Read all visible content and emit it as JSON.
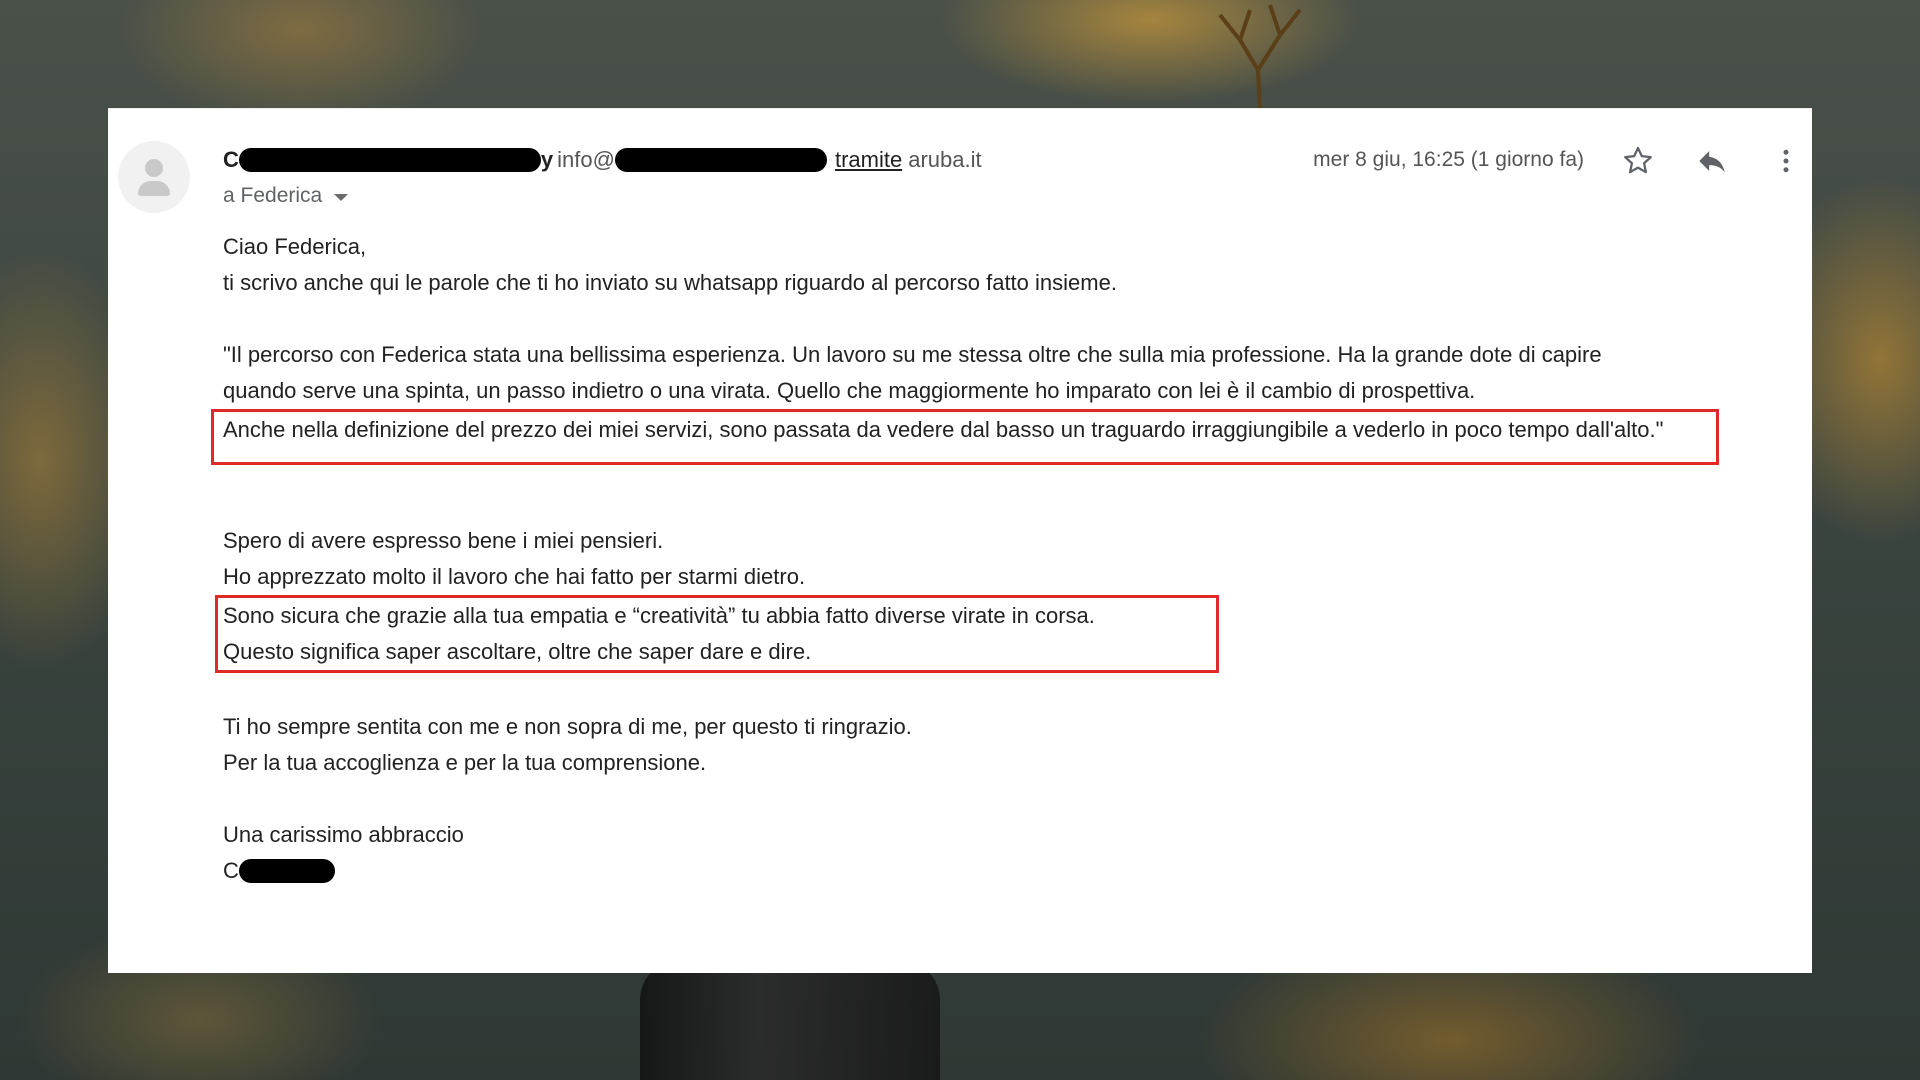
{
  "email": {
    "sender": {
      "name_prefix": "C",
      "name_suffix": "y",
      "email_prefix": "info@",
      "via_label": "tramite",
      "via_domain": "aruba.it"
    },
    "recipient_label": "a Federica",
    "date": "mer 8 giu, 16:25 (1 giorno fa)",
    "body": {
      "greeting": "Ciao Federica,",
      "intro": "ti scrivo anche qui le parole che ti ho inviato su whatsapp riguardo al percorso fatto insieme.",
      "quote_line1": "\"Il percorso con Federica stata una bellissima esperienza. Un lavoro su me stessa oltre che sulla mia professione. Ha la grande dote di capire",
      "quote_line2": "quando serve una spinta, un passo indietro o una virata. Quello che maggiormente ho imparato con lei è il cambio di prospettiva.",
      "quote_highlight": "Anche nella definizione del prezzo dei miei servizi, sono passata da vedere dal basso un traguardo irraggiungibile a vederlo in poco tempo dall'alto.\"",
      "para2_line1": "Spero di avere espresso bene i miei pensieri.",
      "para2_line2": "Ho apprezzato molto il lavoro che hai fatto per starmi dietro.",
      "highlight2_line1": "Sono sicura che grazie alla tua empatia e “creatività” tu abbia fatto diverse virate in corsa.",
      "highlight2_line2": "Questo significa saper ascoltare, oltre che saper dare e dire.",
      "para3_line1": "Ti ho sempre sentita con me e non sopra di me, per questo ti ringrazio.",
      "para3_line2": "Per la tua accoglienza e per la tua comprensione.",
      "closing": "Una carissimo abbraccio",
      "signature_prefix": "C"
    }
  },
  "icons": {
    "avatar": "person-icon",
    "star": "star-icon",
    "reply": "reply-icon",
    "more": "more-vert-icon",
    "caret": "caret-down-icon"
  },
  "colors": {
    "highlight_border": "#e02a2a",
    "text": "#222222",
    "muted": "#5f6368"
  }
}
